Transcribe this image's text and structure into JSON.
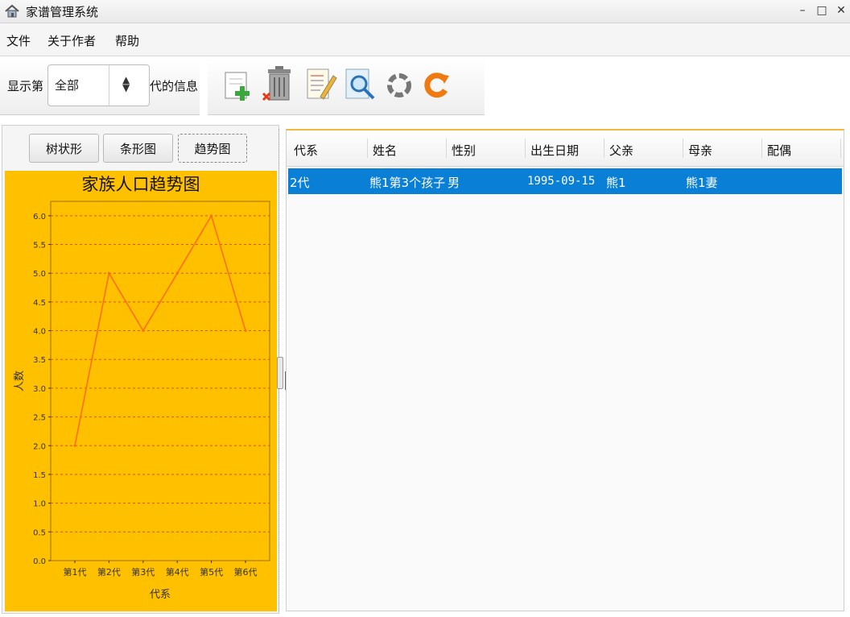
{
  "window": {
    "title": "家谱管理系统",
    "minimize": "–",
    "maximize": "□",
    "close": "✕"
  },
  "menu": [
    "文件",
    "关于作者",
    "帮助"
  ],
  "toolbar": {
    "label_prefix": "显示第",
    "generation_selected": "全部",
    "label_suffix": "代的信息",
    "buttons": [
      "add-icon",
      "delete-icon",
      "edit-icon",
      "search-icon",
      "reset-icon",
      "refresh-icon"
    ]
  },
  "tabs": [
    "树状形",
    "条形图",
    "趋势图"
  ],
  "active_tab": "趋势图",
  "chart_data": {
    "type": "line",
    "title": "家族人口趋势图",
    "xlabel": "代系",
    "ylabel": "人数",
    "categories": [
      "第1代",
      "第2代",
      "第3代",
      "第4代",
      "第5代",
      "第6代"
    ],
    "values": [
      2,
      5,
      4,
      5,
      6,
      4
    ],
    "ylim": [
      0,
      6.25
    ],
    "yticks": [
      "0.0",
      "0.5",
      "1.0",
      "1.5",
      "2.0",
      "2.5",
      "3.0",
      "3.5",
      "4.0",
      "4.5",
      "5.0",
      "5.5",
      "6.0"
    ],
    "grid": true,
    "background": "#ffc000",
    "line_color": "#ff6a1a",
    "grid_color": "#d9541a"
  },
  "table": {
    "columns": [
      "代系",
      "姓名",
      "性别",
      "出生日期",
      "父亲",
      "母亲",
      "配偶"
    ],
    "rows": [
      [
        "2代",
        "熊1第3个孩子",
        "男",
        "1995-09-15",
        "熊1",
        "熊1妻",
        ""
      ]
    ],
    "selected_row_color": "#0a7fd6"
  }
}
